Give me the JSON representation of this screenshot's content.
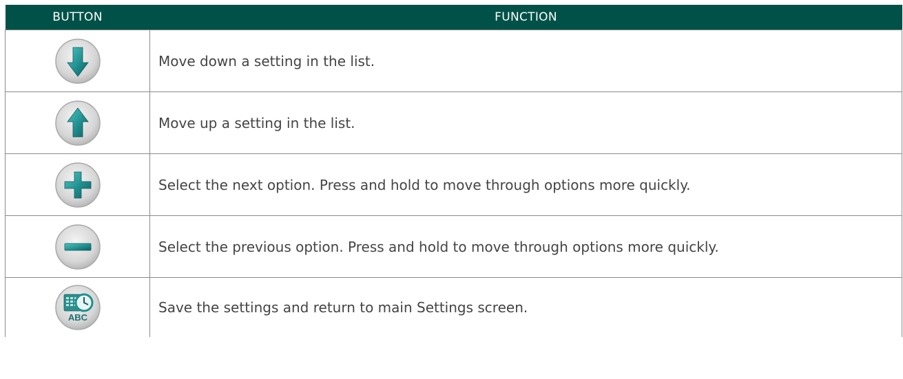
{
  "table": {
    "headers": {
      "button": "BUTTON",
      "function": "FUNCTION"
    },
    "rows": [
      {
        "icon": "arrow-down-icon",
        "description": "Move down a setting in the list."
      },
      {
        "icon": "arrow-up-icon",
        "description": "Move up a setting in the list."
      },
      {
        "icon": "plus-icon",
        "description": "Select the next option. Press and hold to move through options more quickly."
      },
      {
        "icon": "minus-icon",
        "description": "Select the previous option. Press and hold to move through options more quickly."
      },
      {
        "icon": "save-settings-icon",
        "description": "Save the settings and return to main Settings screen.",
        "icon_text": "ABC"
      }
    ]
  },
  "colors": {
    "header_bg": "#005148",
    "header_text": "#ffffff",
    "icon_teal": "#1f8f8f",
    "button_face": "#d9d9d9",
    "body_text": "#444444"
  }
}
